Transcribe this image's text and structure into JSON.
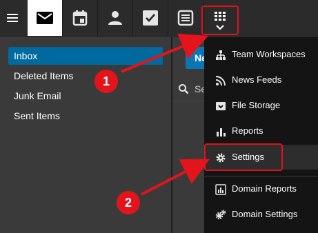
{
  "toolbar": {
    "buttons": [
      {
        "icon": "mail-icon",
        "active": true
      },
      {
        "icon": "calendar-icon",
        "active": false
      },
      {
        "icon": "contacts-icon",
        "active": false
      },
      {
        "icon": "tasks-icon",
        "active": false
      },
      {
        "icon": "notes-icon",
        "active": false
      },
      {
        "icon": "apps-grid-icon",
        "active": false
      }
    ]
  },
  "folders": [
    {
      "label": "Inbox",
      "selected": true
    },
    {
      "label": "Deleted Items",
      "selected": false
    },
    {
      "label": "Junk Email",
      "selected": false
    },
    {
      "label": "Sent Items",
      "selected": false
    }
  ],
  "middle": {
    "new_label": "Ne",
    "search_placeholder": "Se"
  },
  "menu": {
    "items": [
      {
        "label": "Team Workspaces",
        "icon": "sitemap-icon"
      },
      {
        "label": "News Feeds",
        "icon": "rss-icon"
      },
      {
        "label": "File Storage",
        "icon": "file-storage-icon"
      },
      {
        "label": "Reports",
        "icon": "bar-chart-icon"
      },
      {
        "label": "Settings",
        "icon": "gear-icon"
      },
      {
        "label": "Domain Reports",
        "icon": "domain-reports-icon"
      },
      {
        "label": "Domain Settings",
        "icon": "domain-settings-icon"
      }
    ]
  },
  "annotations": {
    "step1": "1",
    "step2": "2",
    "color": "#e3141c"
  },
  "colors": {
    "accent": "#006a9e",
    "toolbar_bg": "#2b2b2b",
    "menu_bg": "#141414"
  }
}
